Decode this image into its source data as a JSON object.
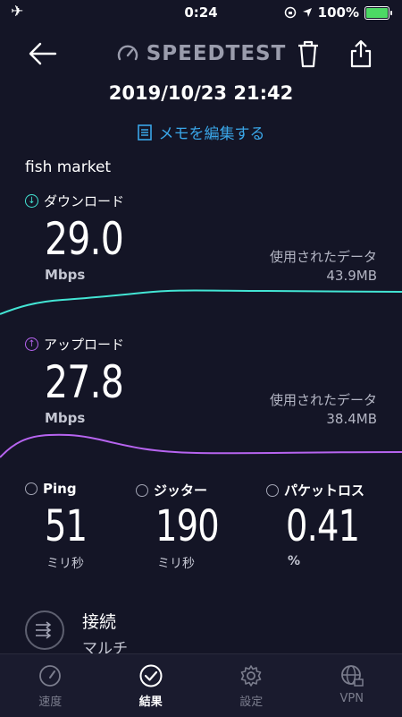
{
  "status": {
    "time": "0:24",
    "battery": "100%"
  },
  "header": {
    "logo": "SPEEDTEST"
  },
  "result": {
    "datetime": "2019/10/23 21:42",
    "memo_label": "メモを編集する",
    "server": "fish market"
  },
  "download": {
    "label": "ダウンロード",
    "value": "29.0",
    "unit": "Mbps",
    "usage_label": "使用されたデータ",
    "usage_value": "43.9MB",
    "color": "#43e5d4"
  },
  "upload": {
    "label": "アップロード",
    "value": "27.8",
    "unit": "Mbps",
    "usage_label": "使用されたデータ",
    "usage_value": "38.4MB",
    "color": "#b764f0"
  },
  "stats": {
    "ping": {
      "label": "Ping",
      "value": "51",
      "unit": "ミリ秒"
    },
    "jitter": {
      "label": "ジッター",
      "value": "190",
      "unit": "ミリ秒"
    },
    "loss": {
      "label": "パケットロス",
      "value": "0.41",
      "unit": "%"
    }
  },
  "connection": {
    "title": "接続",
    "subtitle": "マルチ"
  },
  "tabs": [
    {
      "label": "速度",
      "icon": "speedometer-icon"
    },
    {
      "label": "結果",
      "icon": "check-circle-icon"
    },
    {
      "label": "設定",
      "icon": "gear-icon"
    },
    {
      "label": "VPN",
      "icon": "globe-lock-icon"
    }
  ]
}
